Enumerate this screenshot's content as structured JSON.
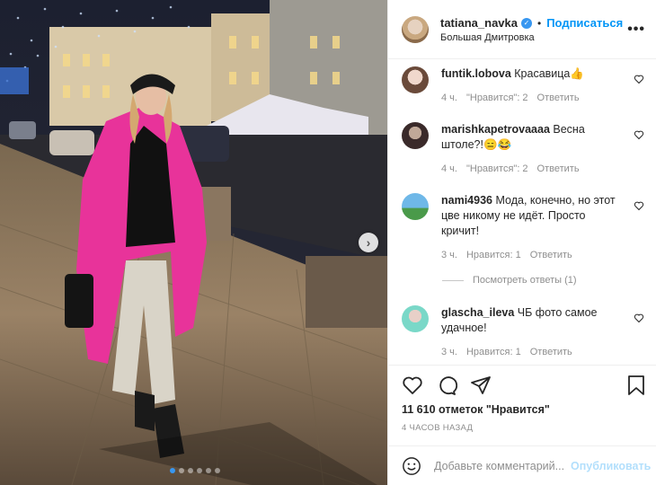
{
  "header": {
    "username": "tatiana_navka",
    "separator": "•",
    "follow_label": "Подписаться",
    "location": "Большая Дмитровка",
    "more_icon": "ellipsis-icon"
  },
  "comments": [
    {
      "username": "funtik.lobova",
      "text": "Красавица👍",
      "time": "4 ч.",
      "likes": "\"Нравится\": 2",
      "reply": "Ответить"
    },
    {
      "username": "marishkapetrovaaaa",
      "text": "Весна штоле?!😑😂",
      "time": "4 ч.",
      "likes": "\"Нравится\": 2",
      "reply": "Ответить"
    },
    {
      "username": "nami4936",
      "text": "Мода, конечно, но этот цве никому не идёт. Просто кричит!",
      "time": "3 ч.",
      "likes": "Нравится: 1",
      "reply": "Ответить"
    },
    {
      "username": "glascha_ileva",
      "text": "ЧБ фото самое удачное!",
      "time": "3 ч.",
      "likes": "Нравится: 1",
      "reply": "Ответить"
    }
  ],
  "view_replies": "Посмотреть ответы (1)",
  "likes_count": "11 610 отметок \"Нравится\"",
  "posted_ago": "4 ЧАСОВ НАЗАД",
  "add_comment": {
    "placeholder": "Добавьте комментарий...",
    "publish_label": "Опубликовать"
  },
  "carousel": {
    "slides": 6,
    "active_index": 0,
    "next_label": "›"
  },
  "colors": {
    "accent": "#0095f6",
    "verified": "#3897f0",
    "coat": "#e8339a"
  }
}
